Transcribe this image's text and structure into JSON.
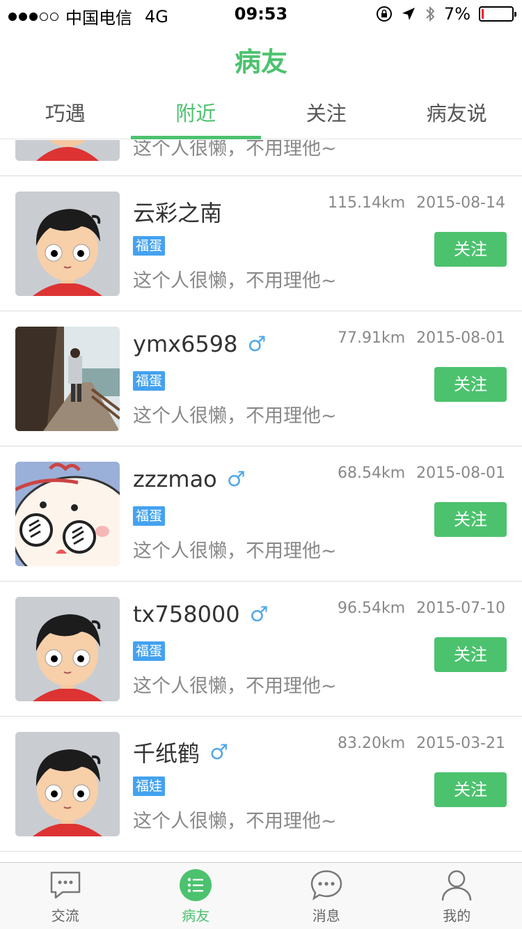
{
  "status_bar": {
    "carrier": "中国电信",
    "network": "4G",
    "time": "09:53",
    "battery": "7%",
    "battery_level": 0.07
  },
  "header": {
    "title": "病友"
  },
  "tabs": [
    {
      "label": "巧遇"
    },
    {
      "label": "附近"
    },
    {
      "label": "关注"
    },
    {
      "label": "病友说"
    }
  ],
  "active_tab": "附近",
  "partial_row": {
    "bio": "这个人很懒，不用理他~"
  },
  "users": [
    {
      "name": "云彩之南",
      "gender": "",
      "tag": "福蛋",
      "bio": "这个人很懒，不用理他~",
      "distance": "115.14km",
      "date": "2015-08-14",
      "follow_label": "关注",
      "avatar": "cartoon-boy"
    },
    {
      "name": "ymx6598",
      "gender": "♂",
      "tag": "福蛋",
      "bio": "这个人很懒，不用理他~",
      "distance": "77.91km",
      "date": "2015-08-01",
      "follow_label": "关注",
      "avatar": "photo-walkway"
    },
    {
      "name": "zzzmao",
      "gender": "♂",
      "tag": "福蛋",
      "bio": "这个人很懒，不用理他~",
      "distance": "68.54km",
      "date": "2015-08-01",
      "follow_label": "关注",
      "avatar": "cartoon-glasses"
    },
    {
      "name": "tx758000",
      "gender": "♂",
      "tag": "福蛋",
      "bio": "这个人很懒，不用理他~",
      "distance": "96.54km",
      "date": "2015-07-10",
      "follow_label": "关注",
      "avatar": "cartoon-boy"
    },
    {
      "name": "千纸鹤",
      "gender": "♂",
      "tag": "福娃",
      "bio": "这个人很懒，不用理他~",
      "distance": "83.20km",
      "date": "2015-03-21",
      "follow_label": "关注",
      "avatar": "cartoon-boy"
    }
  ],
  "tabbar": [
    {
      "label": "交流",
      "icon": "chat-bubble-icon"
    },
    {
      "label": "病友",
      "icon": "list-icon"
    },
    {
      "label": "消息",
      "icon": "message-icon"
    },
    {
      "label": "我的",
      "icon": "profile-icon"
    }
  ],
  "colors": {
    "accent": "#4cc26e",
    "tag": "#44a2f0",
    "gender": "#53a9e8"
  }
}
